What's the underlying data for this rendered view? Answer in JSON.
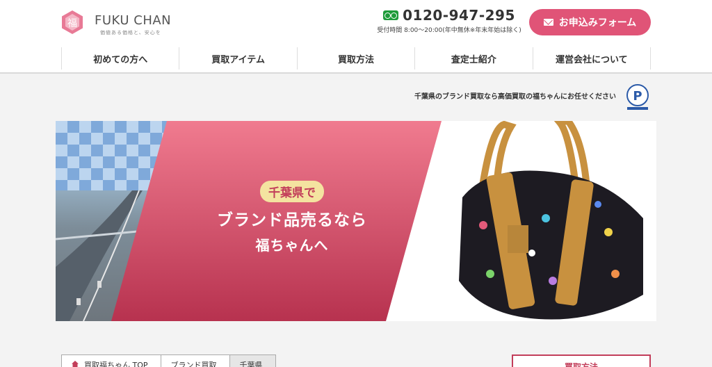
{
  "header": {
    "logo_name": "FUKU CHAN",
    "logo_tagline": "価値ある価格と、安心を",
    "phone_number": "0120-947-295",
    "phone_hours": "受付時間 8:00〜20:00(年中無休※年末年始は除く)",
    "apply_label": "お申込みフォーム"
  },
  "nav": {
    "items": [
      {
        "label": "初めての方へ"
      },
      {
        "label": "買取アイテム"
      },
      {
        "label": "買取方法"
      },
      {
        "label": "査定士紹介"
      },
      {
        "label": "運営会社について"
      }
    ]
  },
  "tagline": "千葉県のブランド買取なら高価買取の福ちゃんにお任せください",
  "hero": {
    "pill": "千葉県で",
    "line1": "ブランド品売るなら",
    "line2": "福ちゃんへ"
  },
  "breadcrumb": {
    "items": [
      {
        "label": "買取福ちゃん TOP"
      },
      {
        "label": "ブランド買取"
      },
      {
        "label": "千葉県"
      }
    ]
  },
  "side_button": "買取方法",
  "colors": {
    "accent": "#e05477",
    "brand_dark": "#c23d5a",
    "freedial_green": "#1e9b3a"
  }
}
